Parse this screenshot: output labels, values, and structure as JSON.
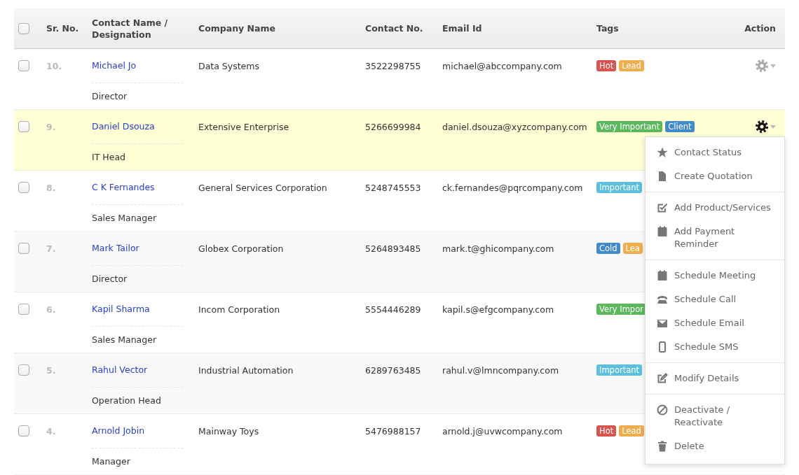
{
  "table": {
    "select_all": {
      "checked": false
    },
    "columns": [
      "Sr. No.",
      "Contact Name / Designation",
      "Company Name",
      "Contact No.",
      "Email Id",
      "Tags",
      "Action"
    ],
    "rows": [
      {
        "checked": false,
        "highlighted": false,
        "menu_open": false,
        "sr": "10.",
        "name": "Michael Jo",
        "designation": "Director",
        "company": "Data Systems",
        "phone": "3522298755",
        "email": "michael@abccompany.com",
        "tags": [
          {
            "label": "Hot",
            "color": "#d9534f"
          },
          {
            "label": "Lead",
            "color": "#f0ad4e"
          }
        ]
      },
      {
        "checked": false,
        "highlighted": true,
        "menu_open": true,
        "sr": "9.",
        "name": "Daniel Dsouza",
        "designation": "IT Head",
        "company": "Extensive Enterprise",
        "phone": "5266699984",
        "email": "daniel.dsouza@xyzcompany.com",
        "tags": [
          {
            "label": "Very Important",
            "color": "#5cb85c"
          },
          {
            "label": "Client",
            "color": "#428bca"
          }
        ]
      },
      {
        "checked": false,
        "highlighted": false,
        "sr": "8.",
        "name": "C K Fernandes",
        "designation": "Sales Manager",
        "company": "General Services Corporation",
        "phone": "5248745553",
        "email": "ck.fernandes@pqrcompany.com",
        "tags": [
          {
            "label": "Important",
            "color": "#5bc0de"
          }
        ]
      },
      {
        "checked": false,
        "highlighted": false,
        "sr": "7.",
        "name": "Mark Tailor",
        "designation": "Director",
        "company": "Globex Corporation",
        "phone": "5264893485",
        "email": "mark.t@ghicompany.com",
        "tags": [
          {
            "label": "Cold",
            "color": "#428bca"
          },
          {
            "label": "Lea",
            "color": "#f0ad4e"
          }
        ]
      },
      {
        "checked": false,
        "highlighted": false,
        "sr": "6.",
        "name": "Kapil Sharma",
        "designation": "Sales Manager",
        "company": "Incom Corporation",
        "phone": "5554446289",
        "email": "kapil.s@efgcompany.com",
        "tags": [
          {
            "label": "Very Impor",
            "color": "#5cb85c"
          }
        ]
      },
      {
        "checked": false,
        "highlighted": false,
        "sr": "5.",
        "name": "Rahul Vector",
        "designation": "Operation Head",
        "company": "Industrial Automation",
        "phone": "6289763485",
        "email": "rahul.v@lmncompany.com",
        "tags": [
          {
            "label": "Important",
            "color": "#5bc0de"
          }
        ]
      },
      {
        "checked": false,
        "highlighted": false,
        "sr": "4.",
        "name": "Arnold Jobin",
        "designation": "Manager",
        "company": "Mainway Toys",
        "phone": "5476988157",
        "email": "arnold.j@uvwcompany.com",
        "tags": [
          {
            "label": "Hot",
            "color": "#d9534f"
          },
          {
            "label": "Lead",
            "color": "#f0ad4e"
          }
        ]
      }
    ]
  },
  "action_menu": {
    "groups": [
      {
        "items": [
          "Contact Status",
          "Create Quotation"
        ]
      },
      {
        "items": [
          "Add Product/Services",
          "Add Payment Reminder"
        ]
      },
      {
        "items": [
          "Schedule Meeting",
          "Schedule Call",
          "Schedule Email",
          "Schedule SMS"
        ]
      },
      {
        "items": [
          "Modify Details"
        ]
      },
      {
        "items": [
          "Deactivate / Reactivate",
          "Delete"
        ]
      }
    ]
  }
}
